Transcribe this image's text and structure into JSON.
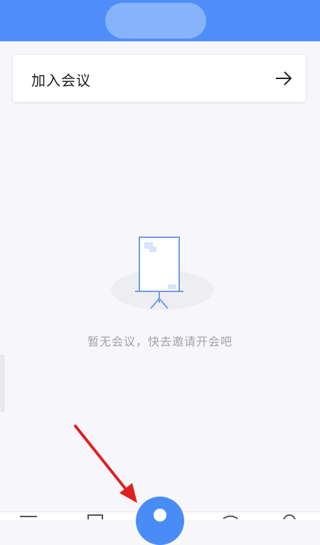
{
  "join_meeting": {
    "label": "加入会议",
    "arrow_icon": "arrow-right-icon"
  },
  "empty_state": {
    "illustration": "projector-screen-icon",
    "message": "暂无会议，快去邀请开会吧"
  },
  "bottom_nav": {
    "fab_icon": "person-icon",
    "items": [
      "calendar-icon",
      "fab",
      "phone-icon",
      "profile-icon"
    ]
  },
  "colors": {
    "header": "#4f8ef8",
    "fab": "#4a8cf6",
    "annotation_arrow": "#e02020",
    "empty_text": "#a3a3a3"
  }
}
